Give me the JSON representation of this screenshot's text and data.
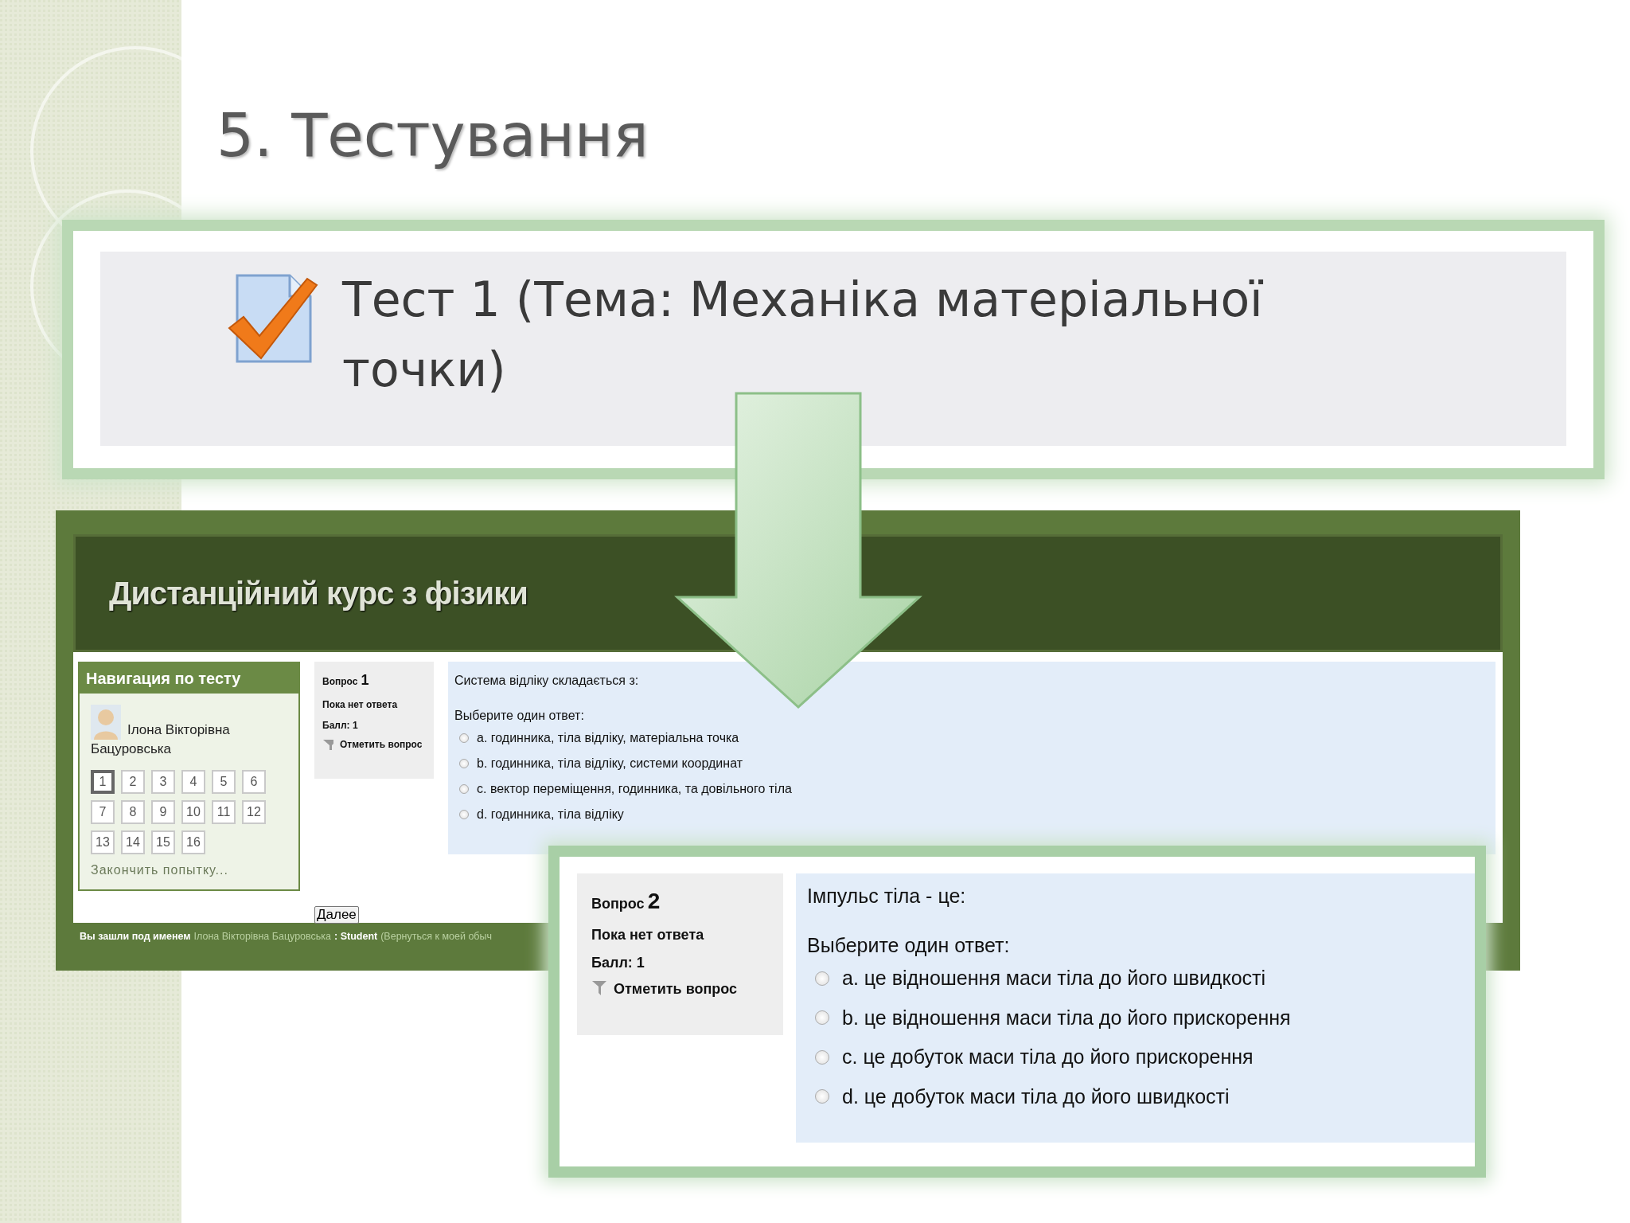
{
  "slide_title": "5. Тестування",
  "test_banner": {
    "title": "Тест 1 (Тема: Механіка матеріальної точки)"
  },
  "course_page": {
    "site_title": "Дистанційний курс з фізики",
    "nav": {
      "title": "Навигация по тесту",
      "user_name": "Ілона Вікторівна Бацуровська",
      "questions": [
        {
          "label": "1",
          "selected": true
        },
        {
          "label": "2",
          "selected": false
        },
        {
          "label": "3",
          "selected": false
        },
        {
          "label": "4",
          "selected": false
        },
        {
          "label": "5",
          "selected": false
        },
        {
          "label": "6",
          "selected": false
        },
        {
          "label": "7",
          "selected": false
        },
        {
          "label": "8",
          "selected": false
        },
        {
          "label": "9",
          "selected": false
        },
        {
          "label": "10",
          "selected": false
        },
        {
          "label": "11",
          "selected": false
        },
        {
          "label": "12",
          "selected": false
        },
        {
          "label": "13",
          "selected": false
        },
        {
          "label": "14",
          "selected": false
        },
        {
          "label": "15",
          "selected": false
        },
        {
          "label": "16",
          "selected": false
        }
      ],
      "finish_link": "Закончить попытку..."
    },
    "question": {
      "label": "Вопрос",
      "number": "1",
      "status": "Пока нет ответа",
      "score": "Балл: 1",
      "flag": "Отметить вопрос",
      "text": "Система відліку складається з:",
      "prompt": "Выберите один ответ:",
      "options": [
        {
          "letter": "a.",
          "text": "годинника, тіла відліку, матеріальна точка",
          "selected": false
        },
        {
          "letter": "b.",
          "text": "годинника, тіла відліку, системи координат",
          "selected": false
        },
        {
          "letter": "c.",
          "text": "вектор переміщення, годинника, та довільного тіла",
          "selected": false
        },
        {
          "letter": "d.",
          "text": "годинника, тіла відліку",
          "selected": false
        }
      ]
    },
    "next_button": "Далее",
    "footer": {
      "label": "Вы зашли под именем",
      "user": "Ілона Вікторівна Бацуровська",
      "role": ": Student",
      "return_link": "(Вернуться к моей обыч"
    }
  },
  "zoomed_question": {
    "label": "Вопрос",
    "number": "2",
    "status": "Пока нет ответа",
    "score": "Балл: 1",
    "flag": "Отметить вопрос",
    "text": "Імпульс тіла - це:",
    "prompt": "Выберите один ответ:",
    "options": [
      {
        "letter": "a.",
        "text": "це відношення маси тіла до його швидкості",
        "selected": false
      },
      {
        "letter": "b.",
        "text": "це відношення маси тіла до його прискорення",
        "selected": false
      },
      {
        "letter": "c.",
        "text": "це добуток маси тіла до його прискорення",
        "selected": false
      },
      {
        "letter": "d.",
        "text": "це добуток маси тіла до його швидкості",
        "selected": false
      }
    ]
  }
}
